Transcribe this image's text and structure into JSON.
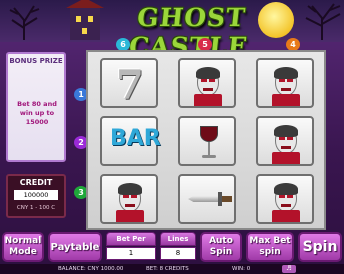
{
  "title": "GHOST CASTLE",
  "bonus": {
    "title": "BONUS PRIZE",
    "text": "Bet 80 and win up to 15000"
  },
  "credit": {
    "title": "CREDIT",
    "value": "100000",
    "rate": "CNY 1 - 100 C"
  },
  "reels": [
    [
      "seven",
      "vampire",
      "vampire"
    ],
    [
      "bar",
      "wine-glass",
      "vampire"
    ],
    [
      "vampire",
      "dagger",
      "vampire"
    ]
  ],
  "line_markers": {
    "top": [
      "6",
      "5",
      "4"
    ],
    "left": [
      "1",
      "2",
      "3"
    ],
    "colors": [
      "#3a78d8",
      "#9b2ad8",
      "#1fa83a",
      "#e87a1a",
      "#d82a4a",
      "#2ab8d8"
    ]
  },
  "buttons": {
    "normal_mode": "Normal Mode",
    "paytable": "Paytable",
    "auto_spin": "Auto Spin",
    "max_bet_spin": "Max Bet spin",
    "spin": "Spin"
  },
  "stakes": {
    "bet_per_line_label": "Bet Per Line",
    "bet_per_line_value": "1",
    "lines_label": "Lines",
    "lines_value": "8"
  },
  "status": {
    "balance": "BALANCE: CNY 1000.00",
    "bet": "BET: 8 CREDITS",
    "win": "WIN: 0"
  },
  "colors": {
    "accent": "#c060c8",
    "title_green": "#9bd63a"
  }
}
